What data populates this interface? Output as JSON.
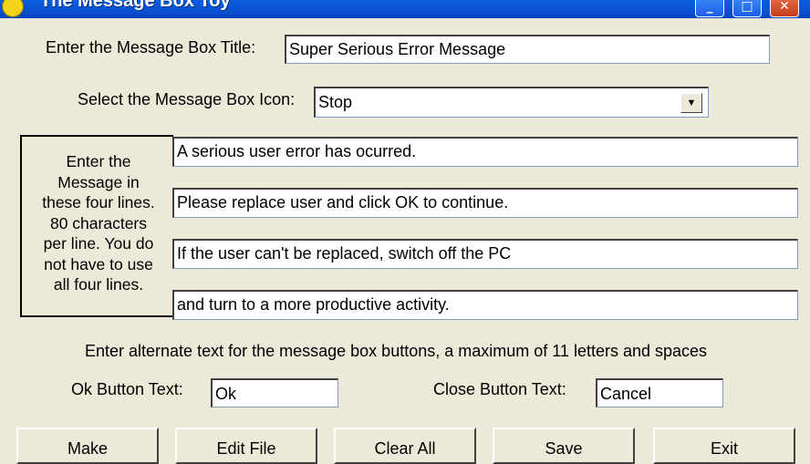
{
  "window": {
    "title": "The Message Box Toy",
    "controls": {
      "minimize": "_",
      "maximize": "□",
      "close": "✕"
    }
  },
  "form": {
    "title_label": "Enter the Message Box Title:",
    "title_value": "Super Serious Error Message",
    "icon_label": "Select the Message Box Icon:",
    "icon_value": "Stop",
    "message_instructions": "Enter the\nMessage in\nthese four lines.\n80 characters\nper line.  You do\nnot have to use\nall four lines.",
    "message_lines": [
      "A serious user error has ocurred.",
      "Please replace user and click OK to continue.",
      "If the user can't be replaced, switch off the PC",
      "and turn to a more productive activity."
    ],
    "alt_text_note": "Enter alternate text for the message box buttons,  a maximum of 11 letters and spaces",
    "ok_label": "Ok Button Text:",
    "ok_value": "Ok",
    "close_label": "Close Button Text:",
    "close_value": "Cancel"
  },
  "buttons": {
    "make": "Make",
    "edit_file": "Edit File",
    "clear_all": "Clear All",
    "save": "Save",
    "exit": "Exit"
  }
}
